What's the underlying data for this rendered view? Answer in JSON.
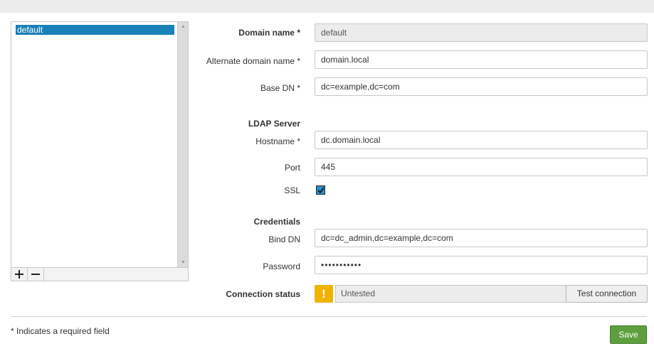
{
  "domains": {
    "items": [
      "default"
    ],
    "add_label": "+",
    "remove_label": "−"
  },
  "form": {
    "domain_name": {
      "label": "Domain name *",
      "value": "default"
    },
    "alternate_domain_name": {
      "label": "Alternate domain name *",
      "value": "domain.local"
    },
    "base_dn": {
      "label": "Base DN *",
      "value": "dc=example,dc=com"
    },
    "ldap_section": "LDAP Server",
    "hostname": {
      "label": "Hostname *",
      "value": "dc.domain.local"
    },
    "port": {
      "label": "Port",
      "value": "445"
    },
    "ssl": {
      "label": "SSL",
      "checked": true
    },
    "credentials_section": "Credentials",
    "bind_dn": {
      "label": "Bind DN",
      "value": "dc=dc_admin,dc=example,dc=com"
    },
    "password": {
      "label": "Password",
      "value": "•••••••••••"
    },
    "connection_status": {
      "label": "Connection status",
      "value": "Untested",
      "icon": "warning-icon"
    },
    "test_connection_label": "Test connection"
  },
  "footer": {
    "required_note": "* Indicates a required field",
    "save_label": "Save"
  },
  "colors": {
    "selection": "#1a80b8",
    "warning": "#f0b400",
    "save": "#5c9f3c",
    "checkbox": "#2a8fc8"
  }
}
